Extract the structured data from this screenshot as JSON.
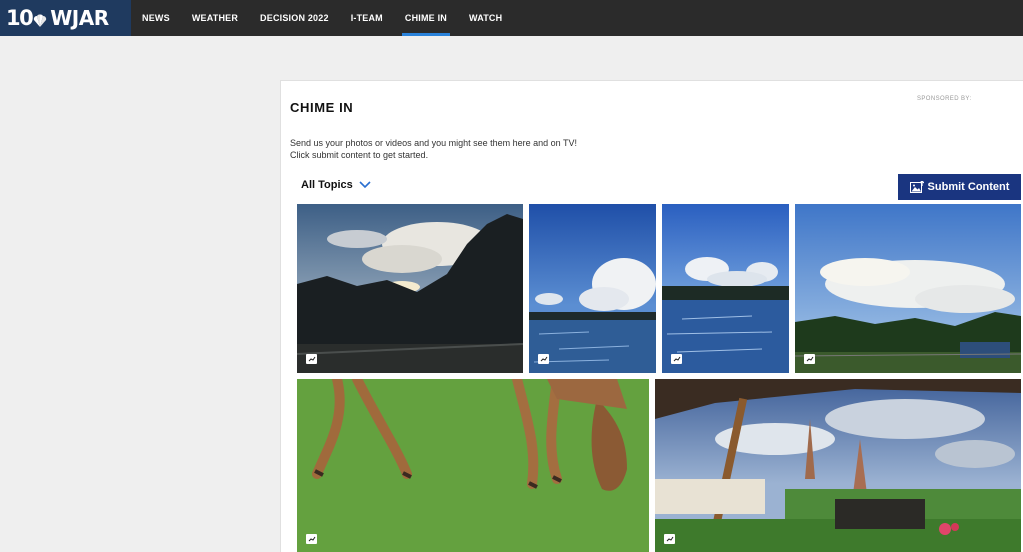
{
  "brand": {
    "channel_number": "10",
    "call_letters": "WJAR",
    "logo_icon": "peacock-icon"
  },
  "nav": {
    "items": [
      {
        "label": "NEWS",
        "active": false
      },
      {
        "label": "WEATHER",
        "active": false
      },
      {
        "label": "DECISION 2022",
        "active": false
      },
      {
        "label": "I-TEAM",
        "active": false
      },
      {
        "label": "CHIME IN",
        "active": true
      },
      {
        "label": "WATCH",
        "active": false
      }
    ]
  },
  "page": {
    "title": "CHIME IN",
    "sponsored_label": "SPONSORED BY:",
    "description_line1": "Send us your photos or videos and you might see them here and on TV!",
    "description_line2": "Click submit content to get started.",
    "topics_filter": {
      "label": "All Topics",
      "icon": "chevron-down-icon"
    },
    "submit_button": {
      "label": "Submit Content",
      "icon": "image-upload-icon"
    }
  },
  "gallery": {
    "badge_icon": "expand-image-icon",
    "photos": [
      {
        "subject": "sunset-clouds-trees"
      },
      {
        "subject": "lake-cumulus-clouds"
      },
      {
        "subject": "lake-sky-clouds"
      },
      {
        "subject": "storm-cloud-field"
      },
      {
        "subject": "deer-grazing"
      },
      {
        "subject": "patio-umbrellas-sky"
      }
    ]
  },
  "colors": {
    "header_bg": "#2b2b2b",
    "logo_bg": "#1f3a5f",
    "nav_active_underline": "#2a82da",
    "submit_button_bg": "#1a3580",
    "topics_chevron": "#2a6fd0"
  }
}
